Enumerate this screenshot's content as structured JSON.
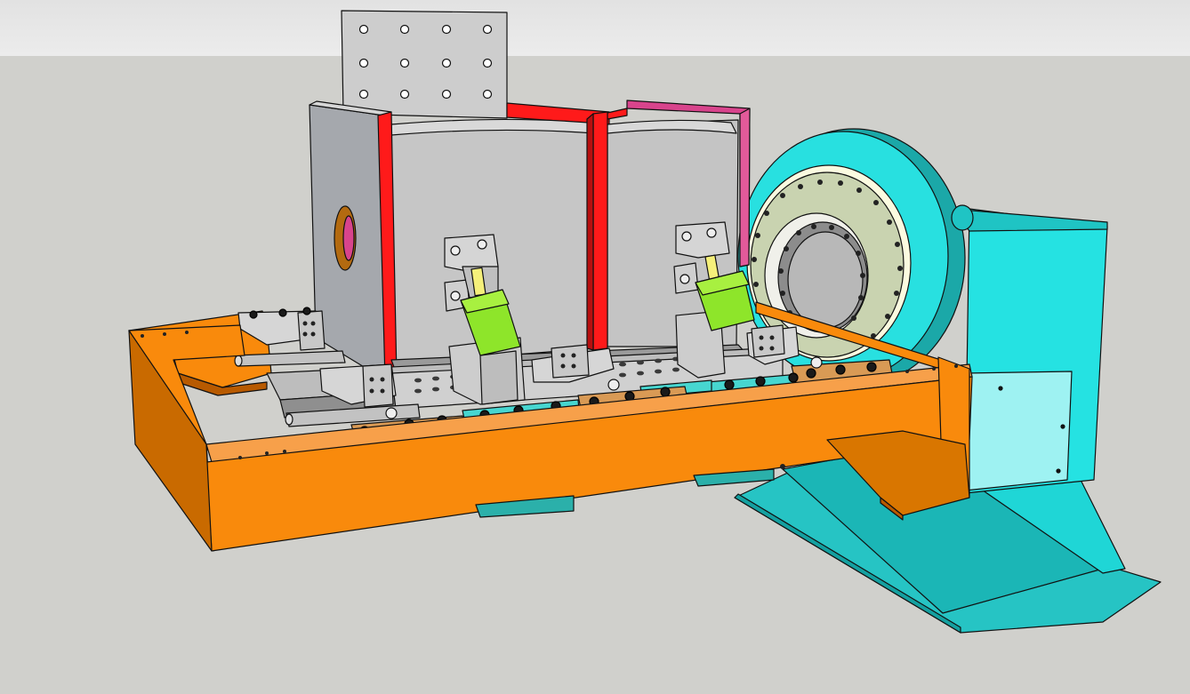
{
  "viewport": {
    "title": "",
    "colors": {
      "sky": "#ececec",
      "ground": "#d0d0cc",
      "frame_orange": "#f98a0c",
      "frame_orange_dark": "#b85a00",
      "positioner_cyan": "#1fe1e1",
      "positioner_cyan_dark": "#1bb6b6",
      "clamp_green": "#8ee52a",
      "plate_gray": "#c8c8c8",
      "red_flange": "#ff1a1a",
      "magenta_plate": "#d8448c",
      "bolt_black": "#1a1a1a",
      "tan_base": "#d99a55",
      "teal_base": "#47d6d0",
      "ring_face": "#c9d3b0"
    },
    "scene_objects": [
      "welding-fixture-frame",
      "rotary-positioner",
      "workpiece-box",
      "mounting-plate",
      "toggle-clamp-left",
      "toggle-clamp-right",
      "clamp-cylinder-left",
      "clamp-cylinder-right",
      "hold-down-clamps",
      "locator-rail"
    ]
  }
}
